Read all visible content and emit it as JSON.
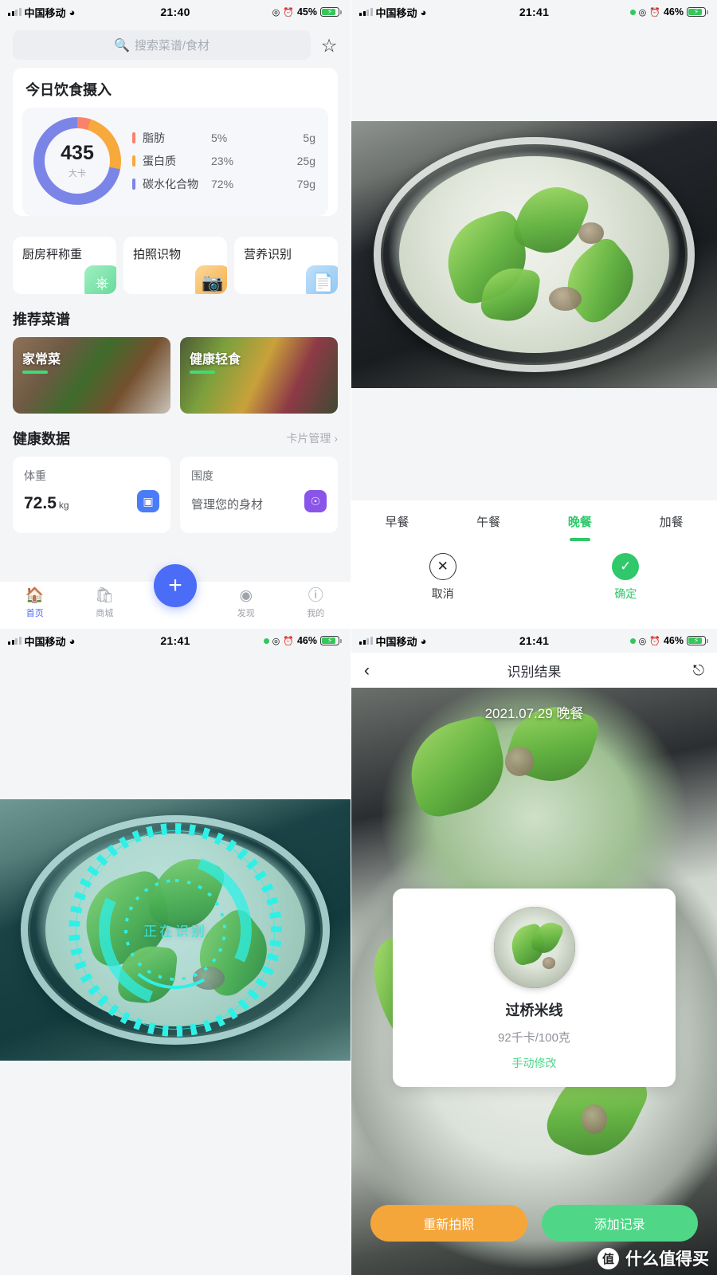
{
  "panels": {
    "home": {
      "status": {
        "carrier": "中国移动",
        "time": "21:40",
        "battery": "45%"
      },
      "search": {
        "placeholder": "搜索菜谱/食材",
        "icon": "search-icon",
        "favorite_icon": "star-icon"
      },
      "intake": {
        "title": "今日饮食摄入",
        "calories": "435",
        "calories_unit": "大卡",
        "macros": [
          {
            "name": "脂肪",
            "percent": "5%",
            "grams": "5g",
            "color": "#f9836a"
          },
          {
            "name": "蛋白质",
            "percent": "23%",
            "grams": "25g",
            "color": "#f7a93b"
          },
          {
            "name": "碳水化合物",
            "percent": "72%",
            "grams": "79g",
            "color": "#7b85e8"
          }
        ]
      },
      "quick_actions": [
        {
          "label": "厨房秤称重",
          "icon": "scale-icon",
          "color": "#7fe3a6"
        },
        {
          "label": "拍照识物",
          "icon": "camera-icon",
          "color": "#f8c069"
        },
        {
          "label": "营养识别",
          "icon": "document-icon",
          "color": "#9ecdf5"
        }
      ],
      "recipes": {
        "title": "推荐菜谱",
        "items": [
          {
            "name": "家常菜"
          },
          {
            "name": "健康轻食"
          }
        ]
      },
      "health": {
        "title": "健康数据",
        "manage_label": "卡片管理",
        "chevron": "›",
        "cards": [
          {
            "label": "体重",
            "value": "72.5",
            "unit": "kg",
            "icon": "scale-device-icon",
            "color": "#4a7cf7"
          },
          {
            "label": "围度",
            "sub": "管理您的身材",
            "icon": "tape-measure-icon",
            "color": "#8a54e8"
          }
        ]
      },
      "tabbar": {
        "items": [
          {
            "label": "首页",
            "icon": "home-icon",
            "active": true
          },
          {
            "label": "商城",
            "icon": "shop-icon",
            "active": false
          },
          {
            "label": "发现",
            "icon": "discover-icon",
            "active": false
          },
          {
            "label": "我的",
            "icon": "profile-icon",
            "active": false
          }
        ],
        "fab": {
          "icon": "plus-icon",
          "color": "#4a6cf7"
        }
      }
    },
    "meal_picker": {
      "status": {
        "carrier": "中国移动",
        "time": "21:41",
        "battery": "46%"
      },
      "meal_tabs": [
        {
          "label": "早餐",
          "active": false
        },
        {
          "label": "午餐",
          "active": false
        },
        {
          "label": "晚餐",
          "active": true
        },
        {
          "label": "加餐",
          "active": false
        }
      ],
      "cancel": {
        "label": "取消",
        "icon": "close-circle-icon"
      },
      "confirm": {
        "label": "确定",
        "icon": "check-circle-icon",
        "color": "#2fc86a"
      }
    },
    "scanning": {
      "status": {
        "carrier": "中国移动",
        "time": "21:41",
        "battery": "46%"
      },
      "overlay_text": "正在识别",
      "accent": "#2ff0e6"
    },
    "result": {
      "status": {
        "carrier": "中国移动",
        "time": "21:41",
        "battery": "46%"
      },
      "nav": {
        "title": "识别结果",
        "back_icon": "back-chevron-icon",
        "share_icon": "share-icon"
      },
      "date_meal": "2021.07.29 晚餐",
      "food": {
        "name": "过桥米线",
        "calories": "92千卡/100克",
        "edit_label": "手动修改"
      },
      "actions": [
        {
          "label": "重新拍照",
          "color": "#f5a63b"
        },
        {
          "label": "添加记录",
          "color": "#4fd787"
        }
      ],
      "watermark": {
        "logo": "值",
        "text": "什么值得买"
      }
    }
  }
}
